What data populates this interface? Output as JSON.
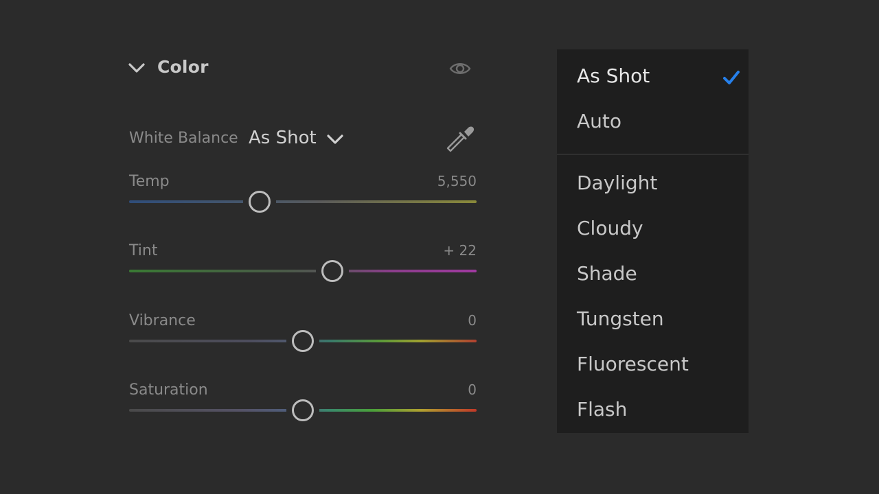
{
  "panel": {
    "title": "Color",
    "white_balance": {
      "label": "White Balance",
      "value": "As Shot"
    },
    "sliders": [
      {
        "label": "Temp",
        "value": "5,550",
        "position": 0.375
      },
      {
        "label": "Tint",
        "value": "+ 22",
        "position": 0.585
      },
      {
        "label": "Vibrance",
        "value": "0",
        "position": 0.5
      },
      {
        "label": "Saturation",
        "value": "0",
        "position": 0.5
      }
    ]
  },
  "menu": {
    "selected": "As Shot",
    "items": [
      "As Shot",
      "Auto",
      "Daylight",
      "Cloudy",
      "Shade",
      "Tungsten",
      "Fluorescent",
      "Flash"
    ],
    "check_color": "#2680eb"
  },
  "icons": {
    "collapse": "chevron-down-icon",
    "visibility": "eye-icon",
    "dropdown": "chevron-down-icon",
    "picker": "eyedropper-icon",
    "selected": "check-icon"
  }
}
